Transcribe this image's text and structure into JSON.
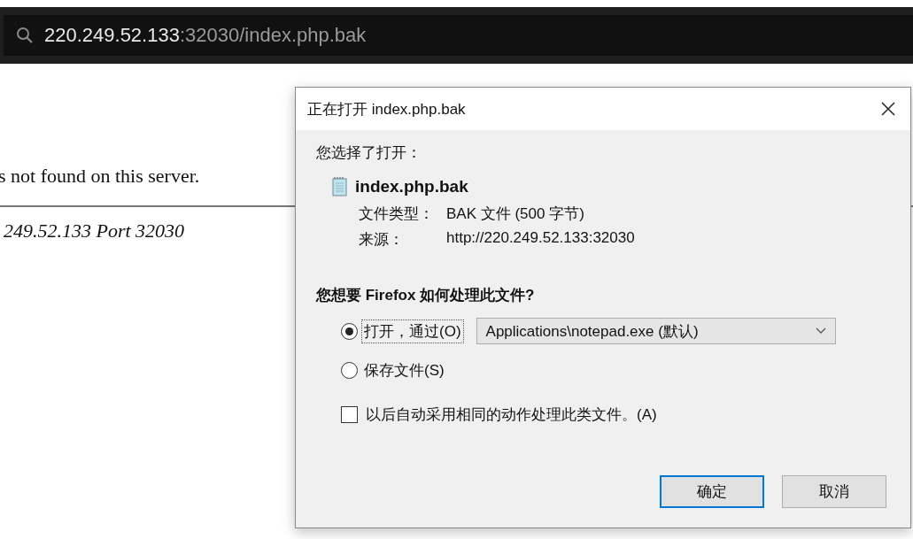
{
  "address_bar": {
    "host": "220.249.52.133",
    "rest": ":32030/index.php.bak"
  },
  "page": {
    "message": "s not found on this server.",
    "footer": "249.52.133 Port 32030"
  },
  "dialog": {
    "title": "正在打开 index.php.bak",
    "intro": "您选择了打开：",
    "file_name": "index.php.bak",
    "details": [
      {
        "label": "文件类型：",
        "value": "BAK 文件 (500 字节)"
      },
      {
        "label": "来源：",
        "value": "http://220.249.52.133:32030"
      }
    ],
    "question": "您想要 Firefox 如何处理此文件?",
    "options": [
      {
        "label": "打开，通过(O)",
        "selected": true,
        "app": "Applications\\notepad.exe (默认)"
      },
      {
        "label": "保存文件(S)",
        "selected": false
      }
    ],
    "remember": {
      "label": "以后自动采用相同的动作处理此类文件。(A)",
      "checked": false
    },
    "buttons": [
      {
        "label": "确定",
        "default": true
      },
      {
        "label": "取消",
        "default": false
      }
    ]
  }
}
